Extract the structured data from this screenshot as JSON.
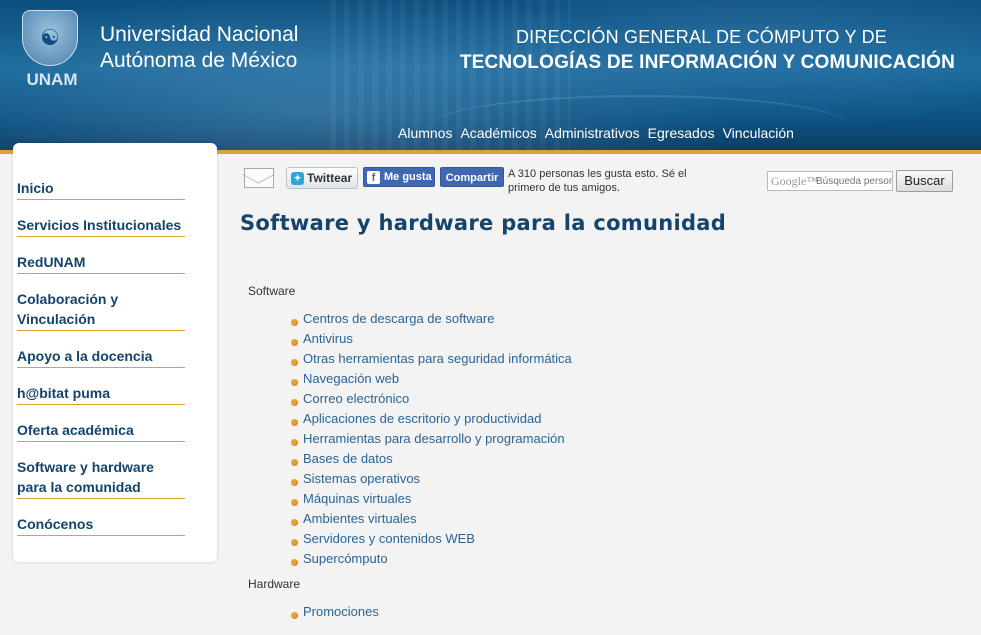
{
  "header": {
    "logo_text": "UNAM",
    "university_line1": "Universidad Nacional",
    "university_line2": "Autónoma de México",
    "dependency_line1": "DIRECCIÓN GENERAL DE CÓMPUTO Y DE",
    "dependency_line2": "TECNOLOGÍAS DE INFORMACIÓN Y COMUNICACIÓN",
    "accent_color": "#d7a534",
    "nav": [
      "Alumnos",
      "Académicos",
      "Administrativos",
      "Egresados",
      "Vinculación"
    ]
  },
  "sidebar": {
    "items": [
      {
        "label": "Inicio"
      },
      {
        "label": "Servicios Institucionales"
      },
      {
        "label": "RedUNAM"
      },
      {
        "label": "Colaboración y Vinculación"
      },
      {
        "label": "Apoyo a la docencia"
      },
      {
        "label": "h@bitat puma"
      },
      {
        "label": "Oferta académica"
      },
      {
        "label": "Software y hardware para la comunidad"
      },
      {
        "label": "Conócenos"
      }
    ]
  },
  "social": {
    "email_icon": "envelope-icon",
    "tweet_label": "Twittear",
    "like_label": "Me gusta",
    "share_label": "Compartir",
    "like_count_text": "A 310 personas les gusta esto. Sé el primero de tus amigos."
  },
  "search": {
    "brand": "Google™",
    "placeholder": "Búsqueda personalizada",
    "button_label": "Buscar"
  },
  "main": {
    "title": "Software y hardware para la comunidad",
    "sections": [
      {
        "label": "Software",
        "links": [
          "Centros de descarga de software",
          "Antivirus",
          "Otras herramientas para seguridad informática",
          "Navegación web",
          "Correo electrónico",
          "Aplicaciones de escritorio y productividad",
          "Herramientas para desarrollo y programación",
          "Bases de datos",
          "Sistemas operativos",
          "Máquinas virtuales",
          "Ambientes virtuales",
          "Servidores y contenidos WEB",
          "Supercómputo"
        ]
      },
      {
        "label": "Hardware",
        "links": [
          "Promociones"
        ]
      }
    ]
  }
}
